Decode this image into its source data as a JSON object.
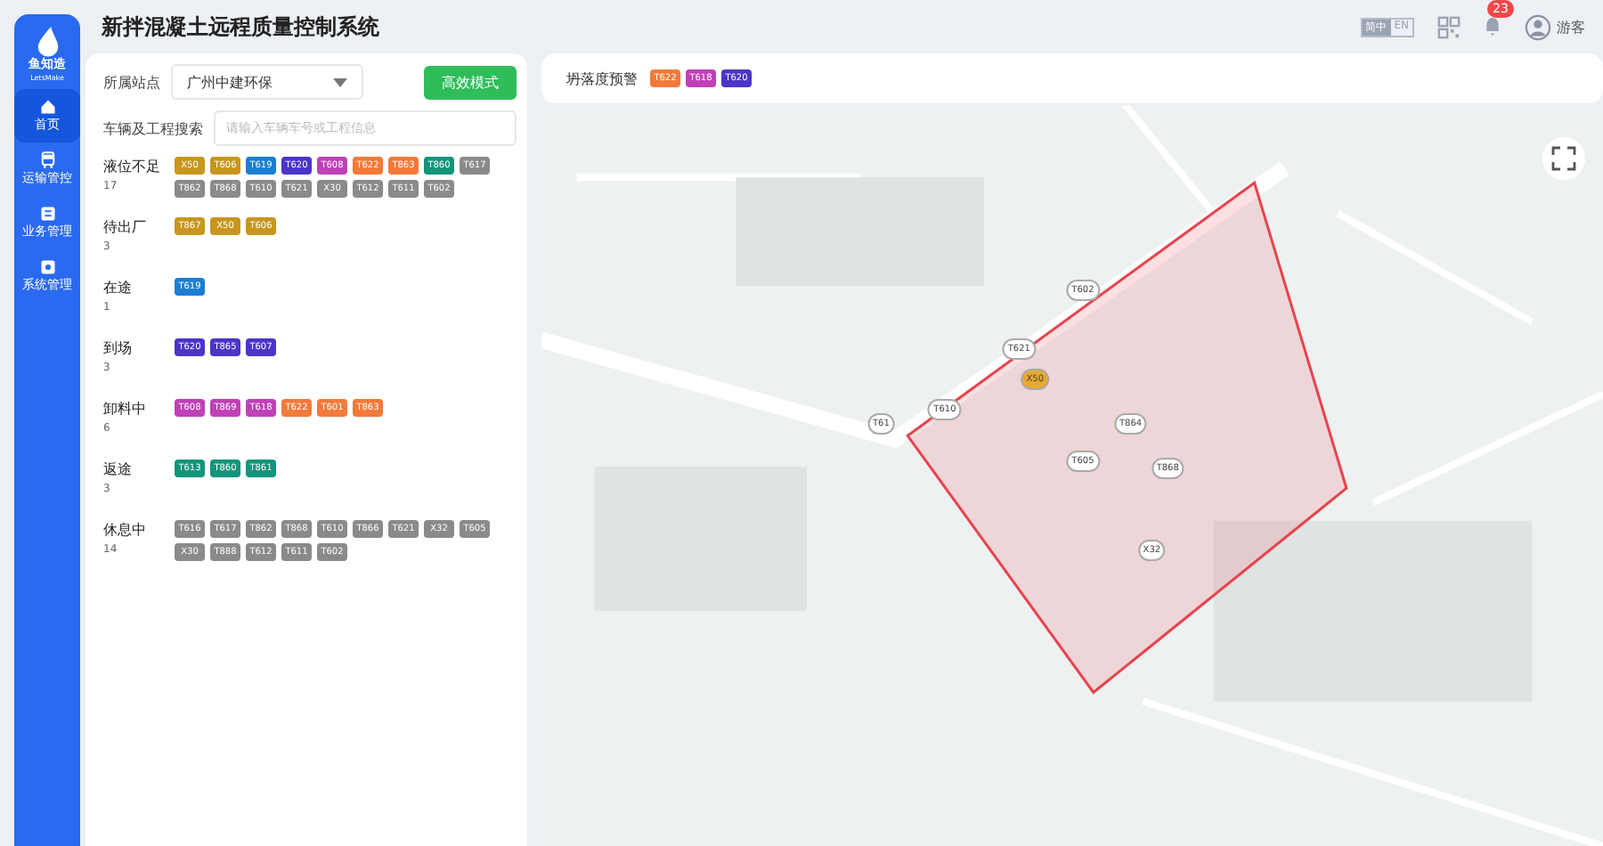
{
  "sidebar": {
    "logo_text": "鱼知造",
    "logo_subtext": "LetsMake",
    "items": [
      {
        "label": "首页",
        "selected": true
      },
      {
        "label": "运输管控",
        "selected": false
      },
      {
        "label": "业务管理",
        "selected": false
      },
      {
        "label": "系统管理",
        "selected": false
      }
    ]
  },
  "header": {
    "title": "新拌混凝土远程质量控制系统",
    "language": [
      {
        "label": "简中",
        "selected": true
      },
      {
        "label": "EN",
        "selected": false
      }
    ],
    "notifications": {
      "count": "23"
    },
    "user": "游客"
  },
  "filters": {
    "station_label": "所属站点",
    "station_value": "广州中建环保",
    "mode_button": "高效模式",
    "search_label": "车辆及工程搜索",
    "search_placeholder": "请输入车辆车号或工程信息"
  },
  "groups": [
    {
      "name": "液位不足",
      "count": "17",
      "vehicles": [
        {
          "id": "X50",
          "color": "#c8961e"
        },
        {
          "id": "T606",
          "color": "#c8961e"
        },
        {
          "id": "T619",
          "color": "#1a7fd4"
        },
        {
          "id": "T620",
          "color": "#4a35c8"
        },
        {
          "id": "T608",
          "color": "#c040b8"
        },
        {
          "id": "T622",
          "color": "#f47a3a"
        },
        {
          "id": "T863",
          "color": "#f47a3a"
        },
        {
          "id": "T860",
          "color": "#12957a"
        },
        {
          "id": "T617",
          "color": "#8a8a8a"
        },
        {
          "id": "T862",
          "color": "#8a8a8a"
        },
        {
          "id": "T868",
          "color": "#8a8a8a"
        },
        {
          "id": "T610",
          "color": "#8a8a8a"
        },
        {
          "id": "T621",
          "color": "#8a8a8a"
        },
        {
          "id": "X30",
          "color": "#8a8a8a"
        },
        {
          "id": "T612",
          "color": "#8a8a8a"
        },
        {
          "id": "T611",
          "color": "#8a8a8a"
        },
        {
          "id": "T602",
          "color": "#8a8a8a"
        }
      ]
    },
    {
      "name": "待出厂",
      "count": "3",
      "vehicles": [
        {
          "id": "T867",
          "color": "#c8961e"
        },
        {
          "id": "X50",
          "color": "#c8961e"
        },
        {
          "id": "T606",
          "color": "#c8961e"
        }
      ]
    },
    {
      "name": "在途",
      "count": "1",
      "vehicles": [
        {
          "id": "T619",
          "color": "#1a7fd4"
        }
      ]
    },
    {
      "name": "到场",
      "count": "3",
      "vehicles": [
        {
          "id": "T620",
          "color": "#4a35c8"
        },
        {
          "id": "T865",
          "color": "#4a35c8"
        },
        {
          "id": "T607",
          "color": "#4a35c8"
        }
      ]
    },
    {
      "name": "卸料中",
      "count": "6",
      "vehicles": [
        {
          "id": "T608",
          "color": "#c040b8"
        },
        {
          "id": "T869",
          "color": "#c040b8"
        },
        {
          "id": "T618",
          "color": "#c040b8"
        },
        {
          "id": "T622",
          "color": "#f47a3a"
        },
        {
          "id": "T601",
          "color": "#f47a3a"
        },
        {
          "id": "T863",
          "color": "#f47a3a"
        }
      ]
    },
    {
      "name": "返途",
      "count": "3",
      "vehicles": [
        {
          "id": "T613",
          "color": "#12957a"
        },
        {
          "id": "T860",
          "color": "#12957a"
        },
        {
          "id": "T861",
          "color": "#12957a"
        }
      ]
    },
    {
      "name": "休息中",
      "count": "14",
      "vehicles": [
        {
          "id": "T616",
          "color": "#8a8a8a"
        },
        {
          "id": "T617",
          "color": "#8a8a8a"
        },
        {
          "id": "T862",
          "color": "#8a8a8a"
        },
        {
          "id": "T868",
          "color": "#8a8a8a"
        },
        {
          "id": "T610",
          "color": "#8a8a8a"
        },
        {
          "id": "T866",
          "color": "#8a8a8a"
        },
        {
          "id": "T621",
          "color": "#8a8a8a"
        },
        {
          "id": "X32",
          "color": "#8a8a8a"
        },
        {
          "id": "T605",
          "color": "#8a8a8a"
        },
        {
          "id": "X30",
          "color": "#8a8a8a"
        },
        {
          "id": "T888",
          "color": "#8a8a8a"
        },
        {
          "id": "T612",
          "color": "#8a8a8a"
        },
        {
          "id": "T611",
          "color": "#8a8a8a"
        },
        {
          "id": "T602",
          "color": "#8a8a8a"
        }
      ]
    }
  ],
  "alert": {
    "label": "坍落度预警",
    "vehicles": [
      {
        "id": "T622",
        "color": "#f47a3a"
      },
      {
        "id": "T618",
        "color": "#c040b8"
      },
      {
        "id": "T620",
        "color": "#4a35c8"
      }
    ]
  },
  "map": {
    "markers": [
      {
        "label": "T602",
        "color": "#ffffff"
      },
      {
        "label": "T621",
        "color": "#ffffff"
      },
      {
        "label": "X50",
        "color": "#e8a930"
      },
      {
        "label": "T610",
        "color": "#ffffff"
      },
      {
        "label": "T61",
        "color": "#ffffff"
      },
      {
        "label": "T864",
        "color": "#ffffff"
      },
      {
        "label": "T605",
        "color": "#ffffff"
      },
      {
        "label": "T868",
        "color": "#ffffff"
      },
      {
        "label": "X32",
        "color": "#ffffff"
      }
    ]
  }
}
